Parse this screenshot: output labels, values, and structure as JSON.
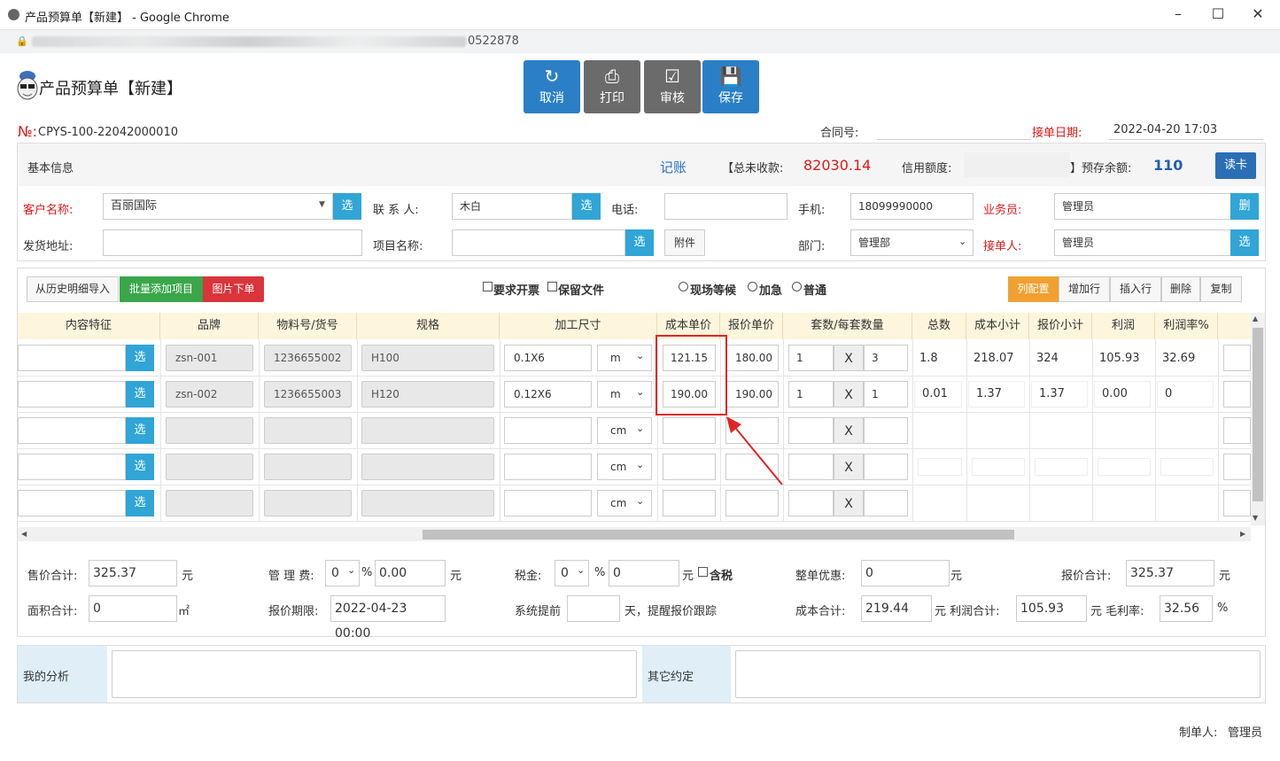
{
  "window": {
    "title": "产品预算单【新建】 - Google Chrome",
    "url_tail": "0522878",
    "controls": [
      "–",
      "☐",
      "✕"
    ]
  },
  "header": {
    "title": "产品预算单【新建】",
    "toolbar": [
      {
        "label": "取消",
        "icon": "undo-icon",
        "glyph": "↻",
        "color": "blue"
      },
      {
        "label": "打印",
        "icon": "print-icon",
        "glyph": "⎙",
        "color": "grey"
      },
      {
        "label": "审核",
        "icon": "check-icon",
        "glyph": "☑",
        "color": "grey"
      },
      {
        "label": "保存",
        "icon": "save-icon",
        "glyph": "💾",
        "color": "blue"
      }
    ],
    "no_label": "№:",
    "no_value": "CPYS-100-22042000010",
    "contract_label": "合同号:",
    "contract_value": "",
    "order_date_label": "接单日期:",
    "order_date_value": "2022-04-20 17:03"
  },
  "basic": {
    "heading": "基本信息",
    "account_link": "记账",
    "total_unpaid_label": "【总未收款:",
    "total_unpaid_value": "82030.14",
    "credit_label": "信用额度:",
    "credit_value": "",
    "prepaid_label": "】预存余额:",
    "prepaid_value": "110",
    "read_card": "读卡",
    "customer_label": "客户名称:",
    "customer_value": "百丽国际",
    "contact_label": "联 系 人:",
    "contact_value": "木白",
    "phone_label": "电话:",
    "phone_value": "",
    "mobile_label": "手机:",
    "mobile_value": "18099990000",
    "salesman_label": "业务员:",
    "salesman_value": "管理员",
    "address_label": "发货地址:",
    "address_value": "",
    "project_label": "项目名称:",
    "project_value": "",
    "attach_label": "附件",
    "dept_label": "部门:",
    "dept_value": "管理部",
    "receiver_label": "接单人:",
    "receiver_value": "管理员",
    "select_btn": "选",
    "delete_btn": "删"
  },
  "items": {
    "import_btn": "从历史明细导入",
    "batch_btn": "批量添加项目",
    "image_btn": "图片下单",
    "invoice_cb": "要求开票",
    "keep_cb": "保留文件",
    "radio1": "现场等候",
    "radio2": "加急",
    "radio3": "普通",
    "col_config": "列配置",
    "add_row": "增加行",
    "insert_row": "插入行",
    "delete_row": "删除",
    "copy_row": "复制",
    "columns": [
      "内容特征",
      "品牌",
      "物料号/货号",
      "规格",
      "加工尺寸",
      "成本单价",
      "报价单价",
      "套数/每套数量",
      "总数",
      "成本小计",
      "报价小计",
      "利润",
      "利润率%"
    ],
    "x_mark": "X",
    "rows": [
      {
        "brand": "zsn-001",
        "part": "1236655002",
        "spec": "H100",
        "size": "0.1X6",
        "unit": "m",
        "cost": "121.15",
        "quote": "180.00",
        "sets": "1",
        "per": "3",
        "total": "1.8",
        "cost_sub": "218.07",
        "quote_sub": "324",
        "profit": "105.93",
        "rate": "32.69"
      },
      {
        "brand": "zsn-002",
        "part": "1236655003",
        "spec": "H120",
        "size": "0.12X6",
        "unit": "m",
        "cost": "190.00",
        "quote": "190.00",
        "sets": "1",
        "per": "1",
        "total": "0.01",
        "cost_sub": "1.37",
        "quote_sub": "1.37",
        "profit": "0.00",
        "rate": "0"
      },
      {
        "brand": "",
        "part": "",
        "spec": "",
        "size": "",
        "unit": "cm",
        "cost": "",
        "quote": "",
        "sets": "",
        "per": "",
        "total": "",
        "cost_sub": "",
        "quote_sub": "",
        "profit": "",
        "rate": ""
      },
      {
        "brand": "",
        "part": "",
        "spec": "",
        "size": "",
        "unit": "cm",
        "cost": "",
        "quote": "",
        "sets": "",
        "per": "",
        "total": "",
        "cost_sub": "",
        "quote_sub": "",
        "profit": "",
        "rate": ""
      },
      {
        "brand": "",
        "part": "",
        "spec": "",
        "size": "",
        "unit": "cm",
        "cost": "",
        "quote": "",
        "sets": "",
        "per": "",
        "total": "",
        "cost_sub": "",
        "quote_sub": "",
        "profit": "",
        "rate": ""
      }
    ]
  },
  "summary": {
    "sale_total_label": "售价合计:",
    "sale_total_value": "325.37",
    "yuan": "元",
    "mgmt_label": "管 理 费:",
    "mgmt_select": "0",
    "pct": "%",
    "mgmt_value": "0.00",
    "tax_label": "税金:",
    "tax_select": "0",
    "tax_value": "0",
    "tax_incl": "含税",
    "discount_label": "整单优惠:",
    "discount_value": "0",
    "quote_total_label": "报价合计:",
    "quote_total_value": "325.37",
    "area_label": "面积合计:",
    "area_value": "0",
    "area_unit": "㎡",
    "quote_deadline_label": "报价期限:",
    "quote_deadline_value": "2022-04-23 00:00",
    "remind_label": "系统提前",
    "remind_value": "",
    "remind_suffix": "天，提醒报价跟踪",
    "cost_total_label": "成本合计:",
    "cost_total_value": "219.44",
    "profit_total_label": "元 利润合计:",
    "profit_total_value": "105.93",
    "margin_label": "元 毛利率:",
    "margin_value": "32.56",
    "margin_pct": "%"
  },
  "notes": {
    "analysis_label": "我的分析",
    "analysis_value": "",
    "other_label": "其它约定",
    "other_value": ""
  },
  "footer": {
    "maker_label": "制单人:",
    "maker_value": "管理员"
  }
}
